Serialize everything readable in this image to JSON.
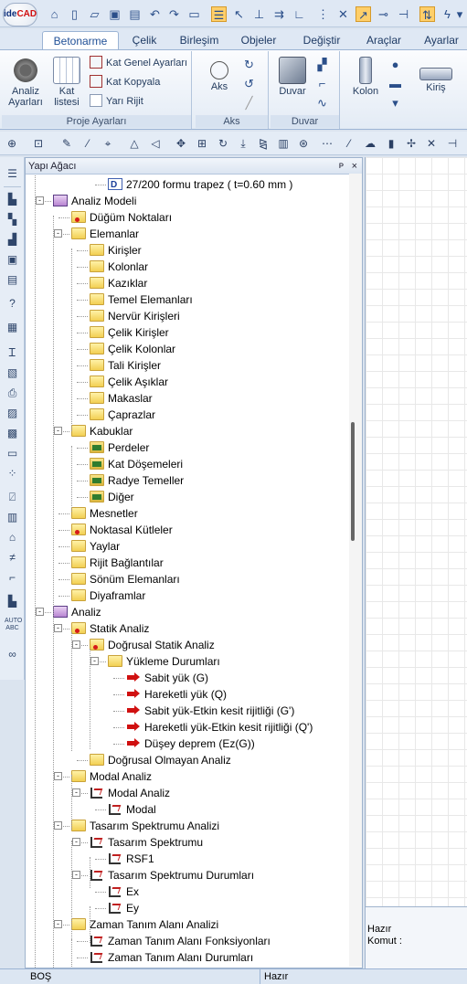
{
  "app": {
    "logo_text_a": "ide",
    "logo_text_b": "CAD"
  },
  "tabs": [
    {
      "label": "Betonarme",
      "active": true
    },
    {
      "label": "Çelik"
    },
    {
      "label": "Birleşim"
    },
    {
      "label": "Objeler"
    },
    {
      "label": "Değiştir"
    },
    {
      "label": "Araçlar"
    },
    {
      "label": "Ayarlar"
    }
  ],
  "ribbon": {
    "proje": {
      "title": "Proje Ayarları",
      "analiz_label": "Analiz Ayarları",
      "katlistesi_label": "Kat listesi",
      "kat_genel": "Kat Genel Ayarları",
      "kat_kopyala": "Kat Kopyala",
      "yari_rijit": "Yarı Rijit"
    },
    "aks": {
      "title": "Aks",
      "label": "Aks"
    },
    "duvar": {
      "title": "Duvar",
      "label": "Duvar"
    },
    "kolon": {
      "label": "Kolon"
    },
    "kiris": {
      "label": "Kiriş"
    }
  },
  "panel": {
    "title": "Yapı Ağacı",
    "pin": "ᴘ",
    "close": "×"
  },
  "tree": [
    {
      "label": "27/200 formu trapez ( t=0.60 mm )",
      "icon": "doc",
      "level": 4
    },
    {
      "label": "Analiz Modeli",
      "icon": "model",
      "level": 1,
      "expander": "-"
    },
    {
      "label": "Düğüm Noktaları",
      "icon": "folder-red",
      "level": 2
    },
    {
      "label": "Elemanlar",
      "icon": "folder",
      "level": 2,
      "expander": "-"
    },
    {
      "label": "Kirişler",
      "icon": "folder",
      "level": 3
    },
    {
      "label": "Kolonlar",
      "icon": "folder",
      "level": 3
    },
    {
      "label": "Kazıklar",
      "icon": "folder",
      "level": 3
    },
    {
      "label": "Temel Elemanları",
      "icon": "folder",
      "level": 3
    },
    {
      "label": "Nervür Kirişleri",
      "icon": "folder",
      "level": 3
    },
    {
      "label": "Çelik Kirişler",
      "icon": "folder",
      "level": 3
    },
    {
      "label": "Çelik Kolonlar",
      "icon": "folder",
      "level": 3
    },
    {
      "label": "Tali Kirişler",
      "icon": "folder",
      "level": 3
    },
    {
      "label": "Çelik Aşıklar",
      "icon": "folder",
      "level": 3
    },
    {
      "label": "Makaslar",
      "icon": "folder",
      "level": 3
    },
    {
      "label": "Çaprazlar",
      "icon": "folder",
      "level": 3
    },
    {
      "label": "Kabuklar",
      "icon": "folder",
      "level": 2,
      "expander": "-"
    },
    {
      "label": "Perdeler",
      "icon": "folder-green",
      "level": 3
    },
    {
      "label": "Kat Döşemeleri",
      "icon": "folder-green",
      "level": 3
    },
    {
      "label": "Radye Temeller",
      "icon": "folder-green",
      "level": 3
    },
    {
      "label": "Diğer",
      "icon": "folder-green",
      "level": 3
    },
    {
      "label": "Mesnetler",
      "icon": "folder",
      "level": 2
    },
    {
      "label": "Noktasal Kütleler",
      "icon": "folder-red",
      "level": 2
    },
    {
      "label": "Yaylar",
      "icon": "folder",
      "level": 2
    },
    {
      "label": "Rijit Bağlantılar",
      "icon": "folder",
      "level": 2
    },
    {
      "label": "Sönüm Elemanları",
      "icon": "folder",
      "level": 2
    },
    {
      "label": "Diyaframlar",
      "icon": "folder",
      "level": 2
    },
    {
      "label": "Analiz",
      "icon": "model",
      "level": 1,
      "expander": "-"
    },
    {
      "label": "Statik Analiz",
      "icon": "folder-red",
      "level": 2,
      "expander": "-"
    },
    {
      "label": "Doğrusal Statik Analiz",
      "icon": "folder-red",
      "level": 3,
      "expander": "-"
    },
    {
      "label": "Yükleme Durumları",
      "icon": "folder",
      "level": 4,
      "expander": "-"
    },
    {
      "label": "Sabit yük (G)",
      "icon": "arrow",
      "level": 5
    },
    {
      "label": "Hareketli yük (Q)",
      "icon": "arrow",
      "level": 5
    },
    {
      "label": "Sabit yük-Etkin kesit rijitliği (G')",
      "icon": "arrow",
      "level": 5
    },
    {
      "label": "Hareketli yük-Etkin kesit rijitliği (Q')",
      "icon": "arrow",
      "level": 5
    },
    {
      "label": "Düşey deprem (Ez(G))",
      "icon": "arrow",
      "level": 5
    },
    {
      "label": "Doğrusal Olmayan Analiz",
      "icon": "folder",
      "level": 3
    },
    {
      "label": "Modal Analiz",
      "icon": "folder",
      "level": 2,
      "expander": "-"
    },
    {
      "label": "Modal Analiz",
      "icon": "spec",
      "level": 3,
      "expander": "-"
    },
    {
      "label": "Modal",
      "icon": "spec",
      "level": 4
    },
    {
      "label": "Tasarım Spektrumu Analizi",
      "icon": "folder",
      "level": 2,
      "expander": "-"
    },
    {
      "label": "Tasarım Spektrumu",
      "icon": "spec",
      "level": 3,
      "expander": "-"
    },
    {
      "label": "RSF1",
      "icon": "spec",
      "level": 4
    },
    {
      "label": "Tasarım Spektrumu Durumları",
      "icon": "spec",
      "level": 3,
      "expander": "-"
    },
    {
      "label": "Ex",
      "icon": "spec",
      "level": 4
    },
    {
      "label": "Ey",
      "icon": "spec",
      "level": 4
    },
    {
      "label": "Zaman Tanım Alanı Analizi",
      "icon": "folder",
      "level": 2,
      "expander": "-"
    },
    {
      "label": "Zaman Tanım Alanı Fonksiyonları",
      "icon": "spec",
      "level": 3
    },
    {
      "label": "Zaman Tanım Alanı Durumları",
      "icon": "spec",
      "level": 3
    }
  ],
  "command": {
    "line1": "Hazır",
    "line2": "Komut :"
  },
  "status": {
    "left": "BOŞ",
    "right": "Hazır"
  }
}
